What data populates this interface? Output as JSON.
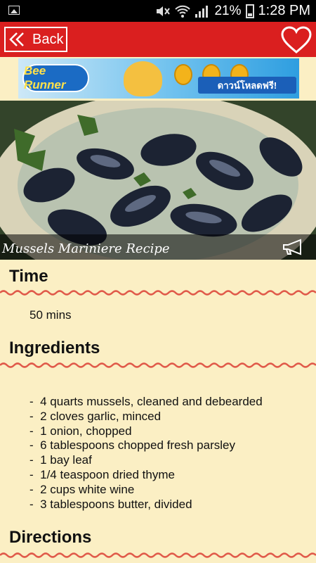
{
  "status_bar": {
    "battery": "21%",
    "time": "1:28 PM"
  },
  "header": {
    "back_label": "Back"
  },
  "ad": {
    "logo_text": "Bee Runner",
    "banner_text": "ดาวน์โหลดฟรี!"
  },
  "recipe": {
    "title": "Mussels Mariniere Recipe",
    "time_heading": "Time",
    "time_value": "50 mins",
    "ingredients_heading": "Ingredients",
    "ingredients": [
      "4 quarts mussels, cleaned and debearded",
      "2 cloves garlic, minced",
      "1 onion, chopped",
      "6 tablespoons chopped fresh parsley",
      "1 bay leaf",
      "1/4 teaspoon dried thyme",
      "2 cups white wine",
      "3 tablespoons butter, divided"
    ],
    "directions_heading": "Directions"
  },
  "colors": {
    "header_red": "#da1f1f",
    "background_cream": "#fbefc4",
    "wave_red": "#e05a4a"
  }
}
